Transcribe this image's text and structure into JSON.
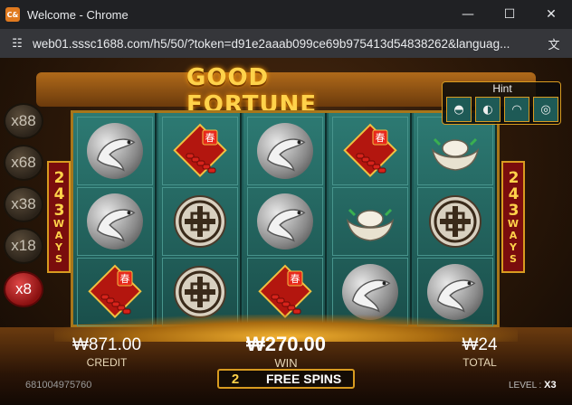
{
  "browser": {
    "app_icon_text": "C&",
    "title": "Welcome - Chrome",
    "minimize_icon": "minimize-icon",
    "maximize_icon": "maximize-icon",
    "close_icon": "close-icon",
    "url": "web01.sssc1688.com/h5/50/?token=d91e2aaab099ce69b975413d54838262&languag...",
    "site_info_icon": "tune-icon",
    "translate_icon": "translate-icon"
  },
  "game": {
    "logo": "GOOD FORTUNE",
    "ways": {
      "number": "243",
      "word": "WAYS"
    },
    "multipliers": [
      {
        "label": "x88",
        "active": false
      },
      {
        "label": "x68",
        "active": false
      },
      {
        "label": "x38",
        "active": false
      },
      {
        "label": "x18",
        "active": false
      },
      {
        "label": "x8",
        "active": true
      }
    ],
    "hint": {
      "label": "Hint",
      "symbols": [
        "ingot-icon",
        "fish-icon",
        "fan-icon",
        "coin-icon"
      ]
    },
    "reels": [
      [
        "fish",
        "fish",
        "firecracker"
      ],
      [
        "firecracker",
        "coin",
        "coin"
      ],
      [
        "fish",
        "fish",
        "firecracker"
      ],
      [
        "firecracker",
        "ingot",
        "fish"
      ],
      [
        "ingot",
        "coin",
        "fish"
      ]
    ],
    "spring_char": "春",
    "credit": {
      "value": "₩871.00",
      "label": "CREDIT"
    },
    "win": {
      "value": "₩270.00",
      "label": "WIN"
    },
    "total": {
      "value": "₩24",
      "label": "TOTAL"
    },
    "free_spins": {
      "count": "2",
      "label": "FREE SPINS"
    },
    "player_id": "681004975760",
    "level": {
      "label": "LEVEL :",
      "value": "X3"
    }
  }
}
